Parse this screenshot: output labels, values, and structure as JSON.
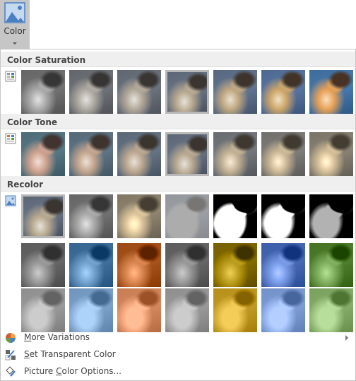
{
  "ribbon": {
    "color_button_label": "Color",
    "icon": "picture-icon",
    "accent": "#4a7fc1"
  },
  "sections": [
    {
      "title": "Color Saturation",
      "icon": "saturation-icon",
      "top": 0,
      "rows": [
        [
          {
            "selected": false
          },
          {
            "selected": false
          },
          {
            "selected": false
          },
          {
            "selected": true
          },
          {
            "selected": false
          },
          {
            "selected": false
          },
          {
            "selected": false
          }
        ]
      ]
    },
    {
      "title": "Color Tone",
      "icon": "tone-icon",
      "rows": [
        [
          {
            "selected": false
          },
          {
            "selected": false
          },
          {
            "selected": false
          },
          {
            "selected": true
          },
          {
            "selected": false
          },
          {
            "selected": false
          },
          {
            "selected": false
          }
        ]
      ]
    },
    {
      "title": "Recolor",
      "icon": "recolor-icon",
      "rows": [
        [
          {
            "selected": true,
            "tint": "none"
          },
          {
            "tint": "grayscale"
          },
          {
            "tint": "sepia"
          },
          {
            "tint": "washout"
          },
          {
            "tint": "black-white-25"
          },
          {
            "tint": "black-white-50"
          },
          {
            "tint": "black-white-75"
          }
        ],
        [
          {
            "tint": "#404040"
          },
          {
            "tint": "#2e5d8a"
          },
          {
            "tint": "#b5622d"
          },
          {
            "tint": "#707070"
          },
          {
            "tint": "#b89a1c"
          },
          {
            "tint": "#3d5ea8"
          },
          {
            "tint": "#5a8a3a"
          }
        ],
        [
          {
            "tint": "#d9d9d9"
          },
          {
            "tint": "#8fb4dc"
          },
          {
            "tint": "#f0a67a"
          },
          {
            "tint": "#c8c8c8"
          },
          {
            "tint": "#f5cf5a"
          },
          {
            "tint": "#8aa8e0"
          },
          {
            "tint": "#a8d08c"
          }
        ]
      ]
    }
  ],
  "menu_items": [
    {
      "pre": "",
      "key": "M",
      "post": "ore Variations",
      "icon": "color-wheel-icon",
      "submenu": true
    },
    {
      "pre": "",
      "key": "S",
      "post": "et Transparent Color",
      "icon": "transparent-color-icon",
      "submenu": false
    },
    {
      "pre": "Picture ",
      "key": "C",
      "post": "olor Options...",
      "icon": "paint-bucket-icon",
      "submenu": false
    }
  ]
}
